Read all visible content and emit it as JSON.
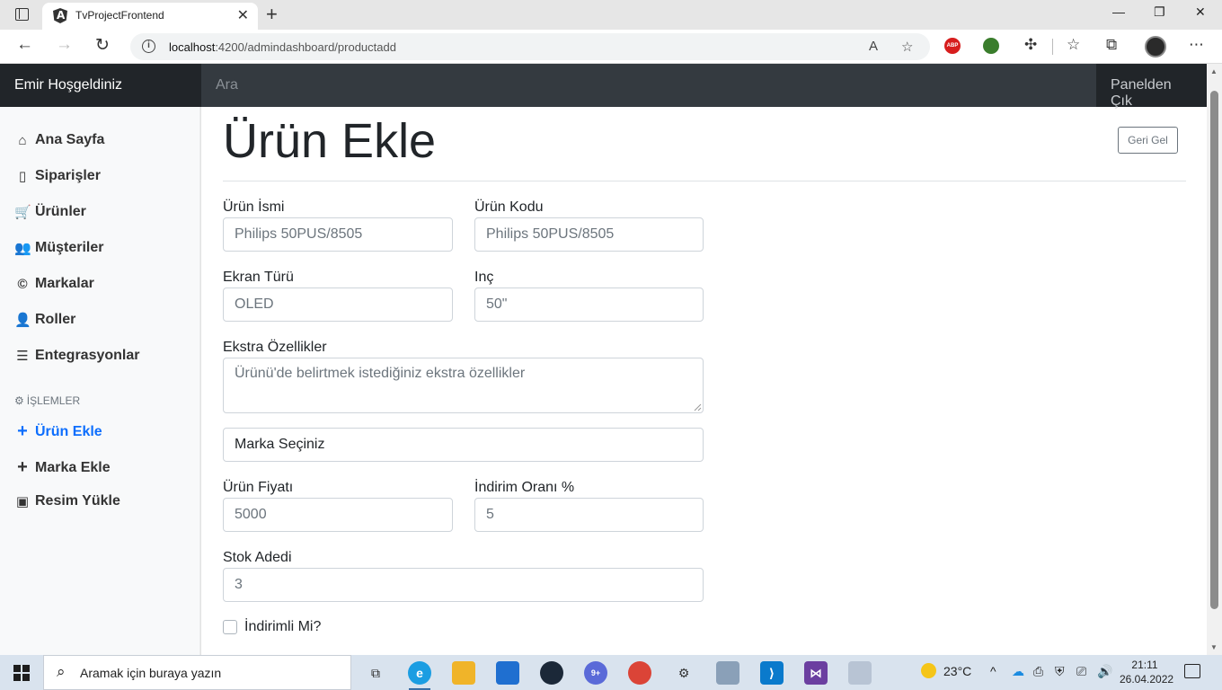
{
  "browser": {
    "tab_title": "TvProjectFrontend",
    "url_host": "localhost",
    "url_path": ":4200/admindashboard/productadd",
    "new_tab_glyph": "+",
    "close_glyph": "✕"
  },
  "navbar": {
    "brand": "Emir Hoşgeldiniz",
    "search_placeholder": "Ara",
    "signout": "Panelden Çık"
  },
  "sidebar": {
    "items": [
      {
        "icon": "home-icon",
        "glyph": "⌂",
        "label": "Ana Sayfa"
      },
      {
        "icon": "file-icon",
        "glyph": "▯",
        "label": "Siparişler"
      },
      {
        "icon": "cart-icon",
        "glyph": "🛒",
        "label": "Ürünler"
      },
      {
        "icon": "users-icon",
        "glyph": "👥",
        "label": "Müşteriler"
      },
      {
        "icon": "copyright-icon",
        "glyph": "©",
        "label": "Markalar"
      },
      {
        "icon": "user-gear-icon",
        "glyph": "👤",
        "label": "Roller"
      },
      {
        "icon": "layers-icon",
        "glyph": "☰",
        "label": "Entegrasyonlar"
      }
    ],
    "section_heading": "İŞLEMLER",
    "section_items": [
      {
        "icon": "plus-icon",
        "glyph": "+",
        "label": "Ürün Ekle",
        "active": true
      },
      {
        "icon": "plus-icon",
        "glyph": "+",
        "label": "Marka Ekle",
        "active": false
      },
      {
        "icon": "image-icon",
        "glyph": "▣",
        "label": "Resim Yükle",
        "active": false
      }
    ]
  },
  "main": {
    "title": "Ürün Ekle",
    "back_button": "Geri Gel",
    "form": {
      "name_label": "Ürün İsmi",
      "name_placeholder": "Philips 50PUS/8505",
      "code_label": "Ürün Kodu",
      "code_placeholder": "Philips 50PUS/8505",
      "screen_label": "Ekran Türü",
      "screen_placeholder": "OLED",
      "inch_label": "Inç",
      "inch_placeholder": "50\"",
      "extra_label": "Ekstra Özellikler",
      "extra_placeholder": "Ürünü'de belirtmek istediğiniz ekstra özellikler",
      "brand_select": "Marka Seçiniz",
      "price_label": "Ürün Fiyatı",
      "price_placeholder": "5000",
      "discount_label": "İndirim Oranı %",
      "discount_placeholder": "5",
      "stock_label": "Stok Adedi",
      "stock_placeholder": "3",
      "discounted_label": "İndirimli Mi?",
      "discounted_checked": false
    }
  },
  "taskbar": {
    "search_text": "Aramak için buraya yazın",
    "temperature": "23°C",
    "time": "21:11",
    "date": "26.04.2022"
  },
  "colors": {
    "navbar_bg": "#343a40",
    "brand_bg": "#212529",
    "active_link": "#0d6efd",
    "sidebar_bg": "#f8f9fa"
  }
}
